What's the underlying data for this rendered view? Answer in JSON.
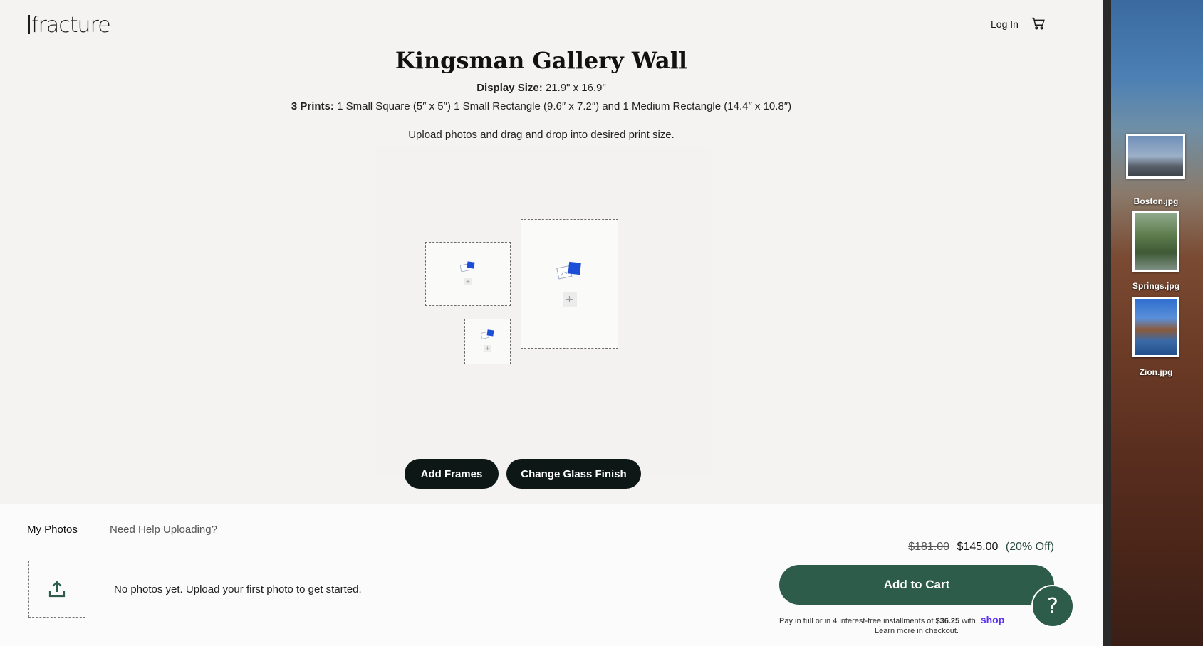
{
  "brand": {
    "logo_text": "fracture"
  },
  "header": {
    "login_label": "Log In"
  },
  "product": {
    "title": "Kingsman Gallery Wall",
    "display_size_label": "Display Size:",
    "display_size_value": "21.9\" x 16.9\"",
    "prints_label": "3 Prints:",
    "prints_value": "1 Small Square (5″ x 5″) 1 Small Rectangle (9.6″ x 7.2″) and 1 Medium Rectangle (14.4″ x 10.8″)",
    "instruction": "Upload photos and drag and drop into desired print size."
  },
  "actions": {
    "add_frames": "Add Frames",
    "change_glass": "Change Glass Finish"
  },
  "photos_panel": {
    "tab_my_photos": "My Photos",
    "tab_help": "Need Help Uploading?",
    "empty_message": "No photos yet. Upload your first photo to get started."
  },
  "pricing": {
    "original": "$181.00",
    "current": "$145.00",
    "discount": "(20% Off)",
    "add_to_cart": "Add to Cart",
    "installments_prefix": "Pay in full or in 4 interest-free installments of",
    "installment_amount": "$36.25",
    "installments_with": "with",
    "shop_pay": "shop",
    "learn_more": "Learn more in checkout."
  },
  "help_button": "?",
  "desktop_files": [
    {
      "name": "Boston.jpg"
    },
    {
      "name": "Springs.jpg"
    },
    {
      "name": "Zion.jpg"
    }
  ],
  "colors": {
    "accent_green": "#2d5c4b",
    "dark_button": "#0c1716",
    "placeholder_blue": "#1d4ed8"
  }
}
